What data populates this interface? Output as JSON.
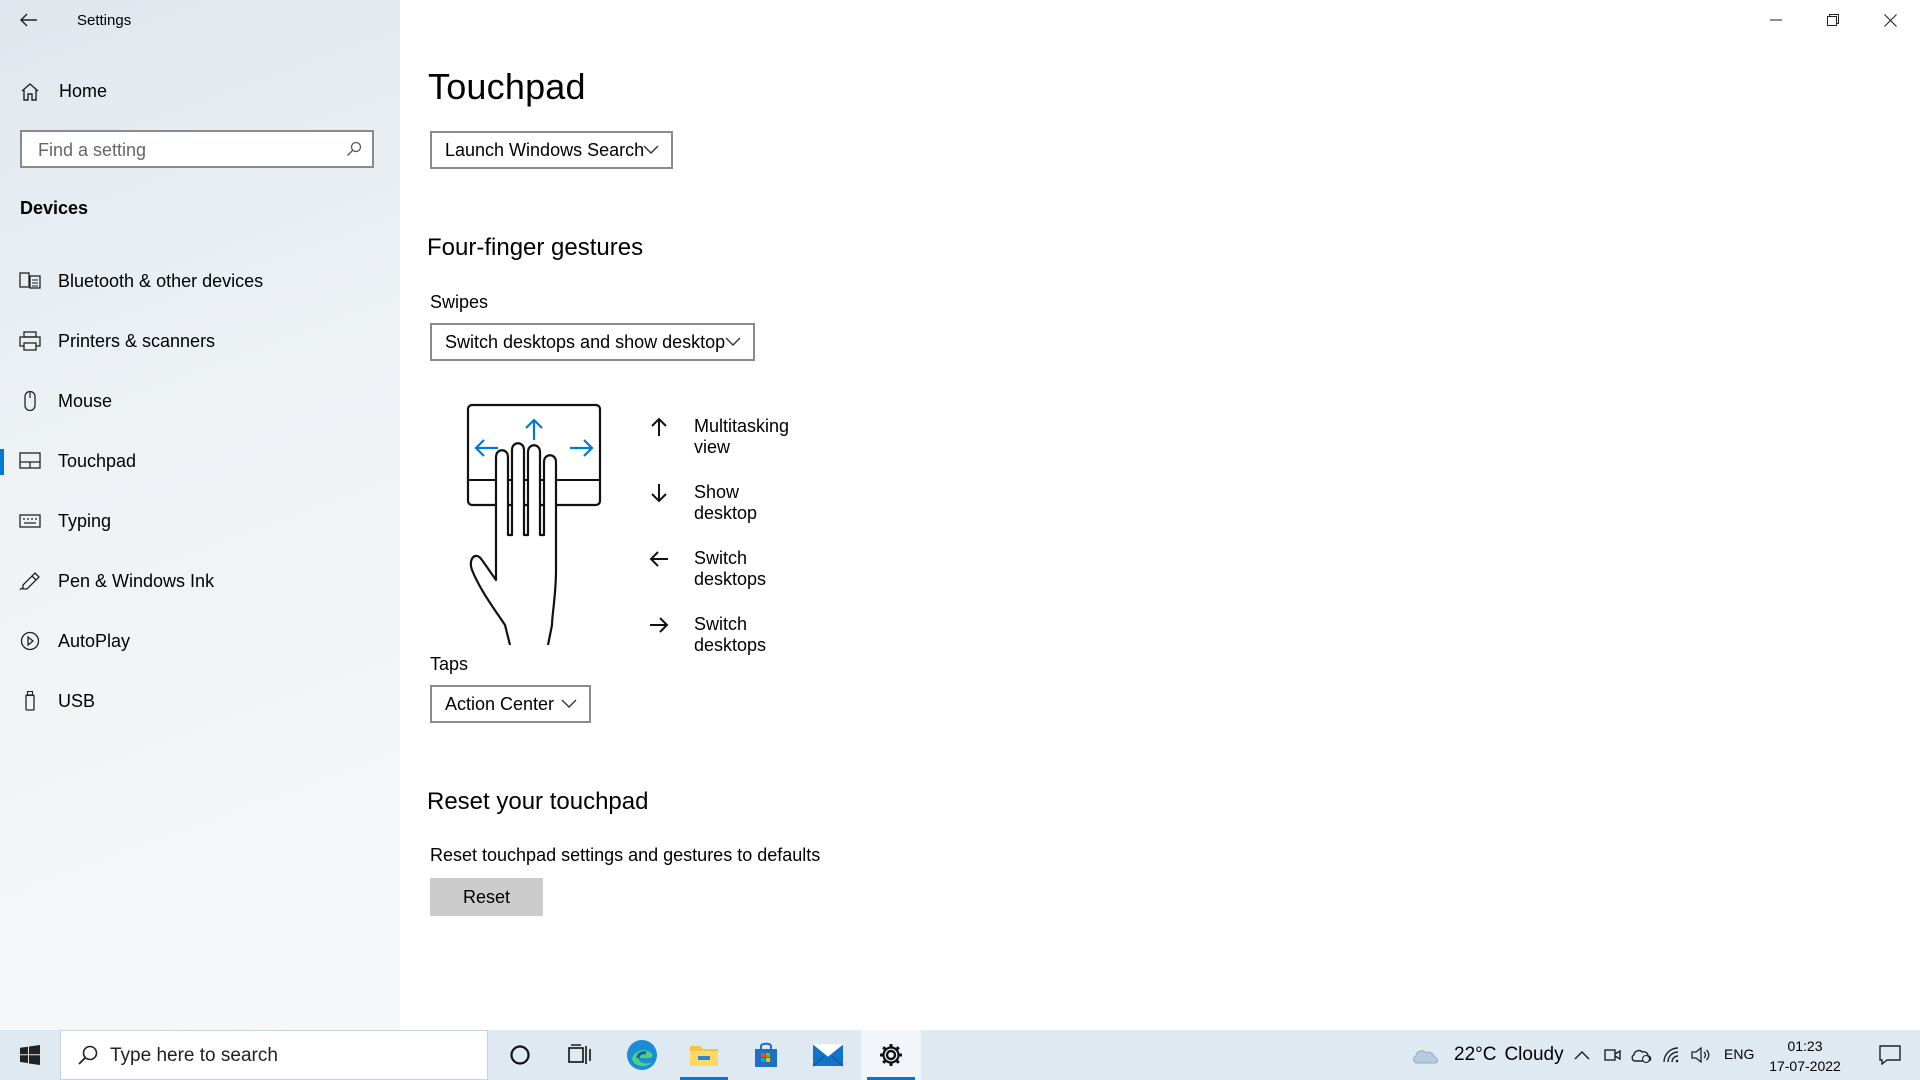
{
  "window": {
    "title": "Settings",
    "minimize_icon": "minimize-icon",
    "restore_icon": "restore-icon",
    "close_icon": "close-icon"
  },
  "sidebar": {
    "home_label": "Home",
    "search_placeholder": "Find a setting",
    "section_title": "Devices",
    "items": [
      {
        "label": "Bluetooth & other devices",
        "icon": "bluetooth-devices-icon"
      },
      {
        "label": "Printers & scanners",
        "icon": "printer-icon"
      },
      {
        "label": "Mouse",
        "icon": "mouse-icon"
      },
      {
        "label": "Touchpad",
        "icon": "touchpad-icon",
        "selected": true
      },
      {
        "label": "Typing",
        "icon": "keyboard-icon"
      },
      {
        "label": "Pen & Windows Ink",
        "icon": "pen-icon"
      },
      {
        "label": "AutoPlay",
        "icon": "autoplay-icon"
      },
      {
        "label": "USB",
        "icon": "usb-icon"
      }
    ]
  },
  "main": {
    "page_title": "Touchpad",
    "three_finger_tap_value": "Launch Windows Search",
    "four_finger": {
      "heading": "Four-finger gestures",
      "swipes_label": "Swipes",
      "swipes_value": "Switch desktops and show desktop",
      "gestures": [
        {
          "direction": "up",
          "label": "Multitasking view"
        },
        {
          "direction": "down",
          "label": "Show desktop"
        },
        {
          "direction": "left",
          "label": "Switch desktops"
        },
        {
          "direction": "right",
          "label": "Switch desktops"
        }
      ],
      "taps_label": "Taps",
      "taps_value": "Action Center"
    },
    "reset": {
      "heading": "Reset your touchpad",
      "description": "Reset touchpad settings and gestures to defaults",
      "button_label": "Reset"
    }
  },
  "taskbar": {
    "search_placeholder": "Type here to search",
    "apps": [
      "cortana-icon",
      "task-view-icon",
      "edge-icon",
      "file-explorer-icon",
      "microsoft-store-icon",
      "mail-icon",
      "settings-icon"
    ],
    "weather": {
      "temp": "22°C",
      "condition": "Cloudy"
    },
    "language": "ENG",
    "time": "01:23",
    "date": "17-07-2022",
    "accent": "#0078d7"
  }
}
